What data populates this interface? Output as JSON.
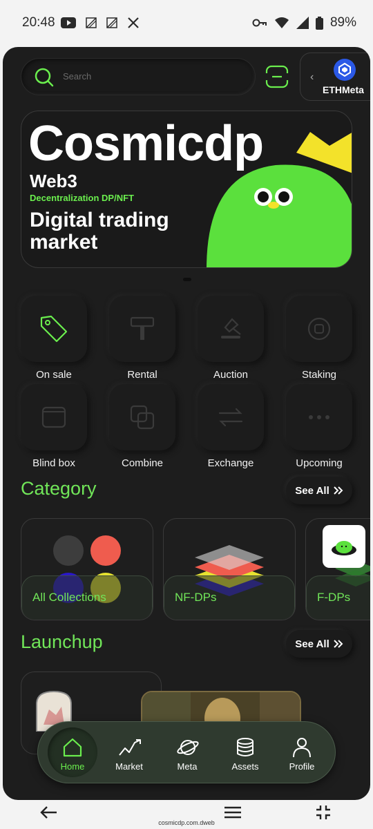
{
  "status_bar": {
    "time": "20:48",
    "battery": "89%",
    "left_icons": [
      "youtube-icon",
      "notification-icon",
      "notification-icon",
      "x-icon"
    ],
    "right_icons": [
      "key-icon",
      "wifi-icon",
      "signal-icon",
      "battery-icon"
    ]
  },
  "header": {
    "search_placeholder": "Search",
    "network_name": "ETHMeta"
  },
  "banner": {
    "brand": "Cosmicdp",
    "web3": "Web3",
    "subtitle": "Decentralization DP/NFT",
    "tagline": "Digital trading market"
  },
  "features": [
    {
      "label": "On sale",
      "icon": "tag-icon"
    },
    {
      "label": "Rental",
      "icon": "roller-icon"
    },
    {
      "label": "Auction",
      "icon": "gavel-icon"
    },
    {
      "label": "Staking",
      "icon": "staking-icon"
    },
    {
      "label": "Blind box",
      "icon": "box-icon"
    },
    {
      "label": "Combine",
      "icon": "combine-icon"
    },
    {
      "label": "Exchange",
      "icon": "exchange-icon"
    },
    {
      "label": "Upcoming",
      "icon": "more-icon"
    }
  ],
  "category": {
    "title": "Category",
    "see_all": "See All",
    "items": [
      {
        "label": "All Collections"
      },
      {
        "label": "NF-DPs"
      },
      {
        "label": "F-DPs"
      }
    ]
  },
  "launchup": {
    "title": "Launchup",
    "see_all": "See All"
  },
  "bottom_nav": [
    {
      "label": "Home",
      "icon": "home-icon",
      "active": true
    },
    {
      "label": "Market",
      "icon": "chart-icon"
    },
    {
      "label": "Meta",
      "icon": "planet-icon"
    },
    {
      "label": "Assets",
      "icon": "coins-icon"
    },
    {
      "label": "Profile",
      "icon": "person-icon"
    }
  ],
  "system_nav": {
    "url": "cosmicdp.com.dweb"
  },
  "colors": {
    "accent": "#71e659",
    "background": "#1d1d1d",
    "nav": "#2f3a2f"
  }
}
